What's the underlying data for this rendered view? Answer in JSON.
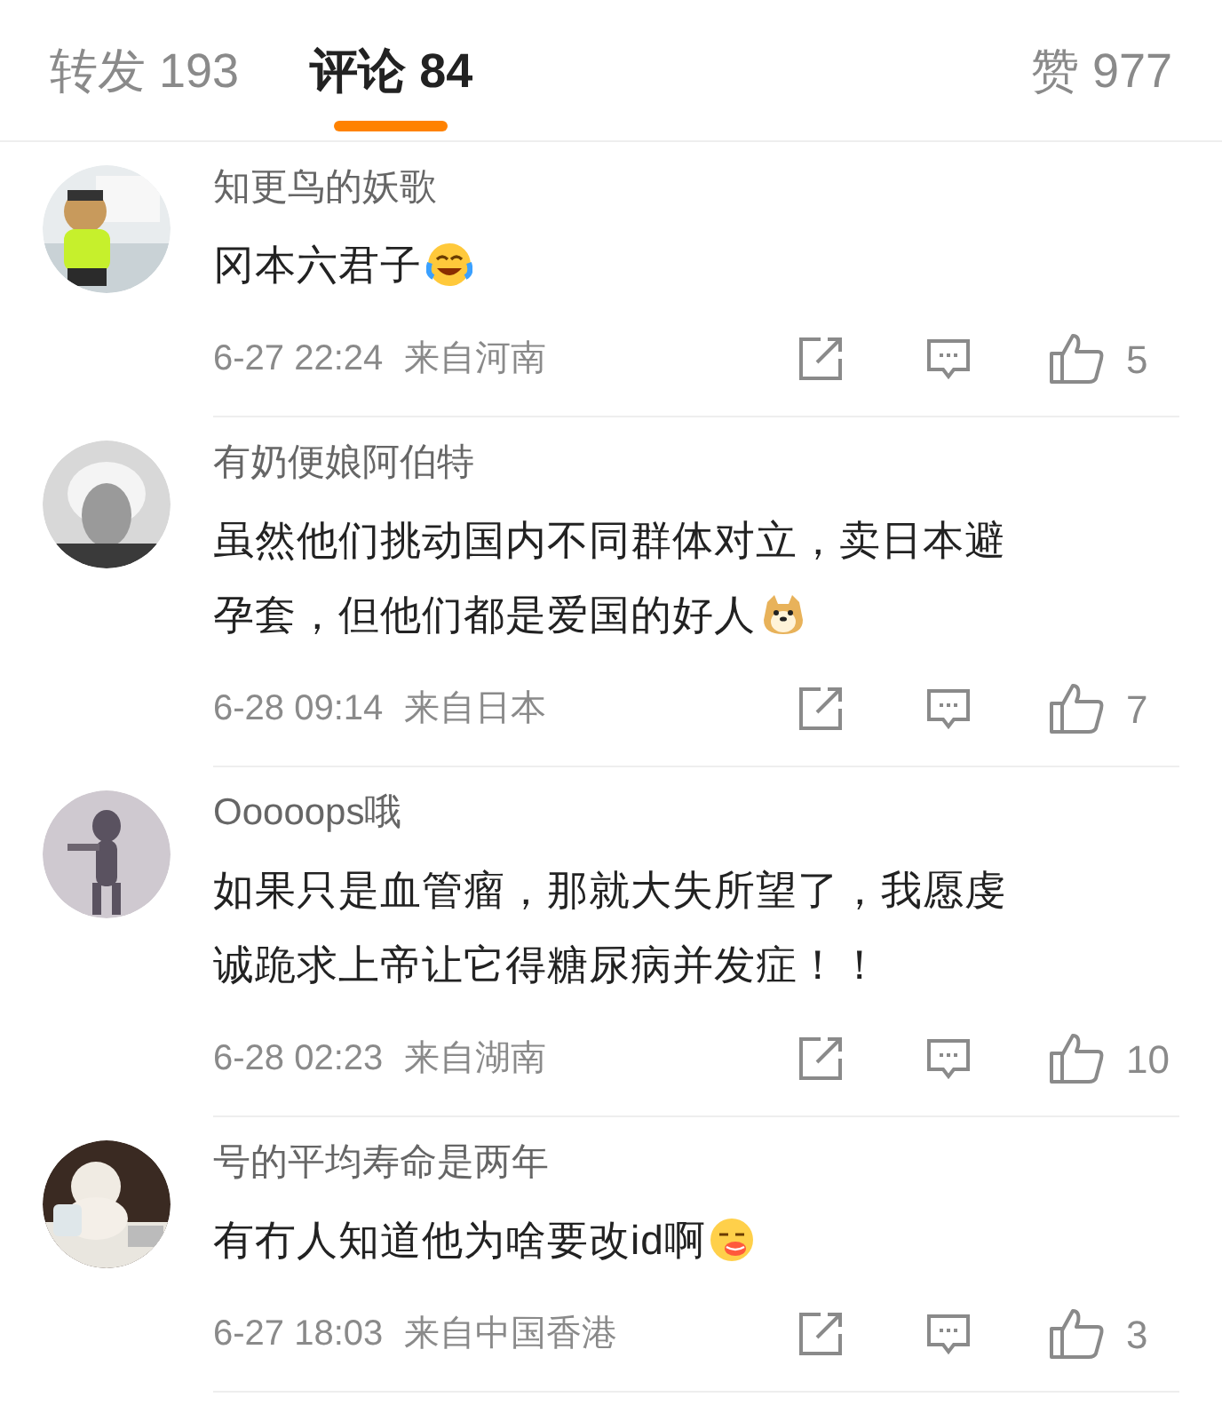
{
  "tabs": [
    {
      "label": "转发",
      "count": "193",
      "selected": false
    },
    {
      "label": "评论",
      "count": "84",
      "selected": true
    },
    {
      "label": "赞",
      "count": "977",
      "selected": false
    }
  ],
  "comments": [
    {
      "name": "知更鸟的妖歌",
      "lines": [
        "冈本六君子"
      ],
      "kind": "laugh",
      "time": "6-27 22:24",
      "location": "来自河南",
      "likes": "5"
    },
    {
      "name": "有奶便娘阿伯特",
      "lines": [
        "虽然他们挑动国内不同群体对立，卖日本避",
        "孕套，但他们都是爱国的好人"
      ],
      "kind": "doge",
      "time": "6-28 09:14",
      "location": "来自日本",
      "likes": "7"
    },
    {
      "name": "Ooooops哦",
      "lines": [
        "如果只是血管瘤，那就大失所望了，我愿虔",
        "诚跪求上帝让它得糖尿病并发症！！"
      ],
      "kind": "plain",
      "time": "6-28 02:23",
      "location": "来自湖南",
      "likes": "10"
    },
    {
      "name": "号的平均寿命是两年",
      "lines": [
        "有冇人知道他为啥要改id啊"
      ],
      "kind": "yum",
      "time": "6-27 18:03",
      "location": "来自中国香港",
      "likes": "3"
    }
  ]
}
